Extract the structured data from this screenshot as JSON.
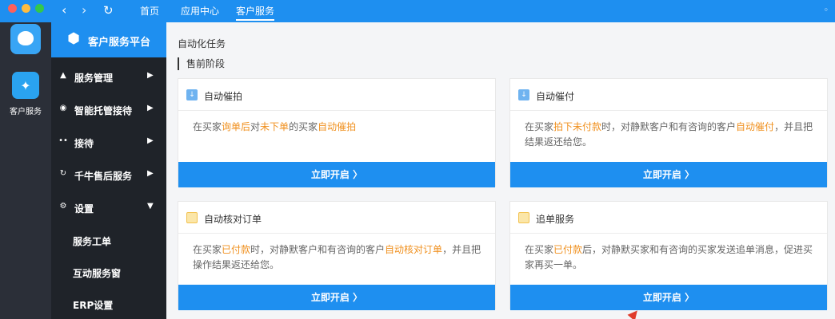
{
  "nav": {
    "back_icon": "chevron-left-icon",
    "forward_icon": "chevron-right-icon",
    "refresh_icon": "refresh-icon",
    "tabs": [
      {
        "label": "首页"
      },
      {
        "label": "应用中心"
      },
      {
        "label": "客户服务",
        "active": true
      }
    ]
  },
  "rail": {
    "app_label": "客户服务"
  },
  "sidebar": {
    "title": "客户服务平台",
    "items": [
      {
        "label": "服务管理",
        "icon": "bell-icon"
      },
      {
        "label": "智能托管接待",
        "icon": "bulb-icon"
      },
      {
        "label": "接待",
        "icon": "users-icon"
      },
      {
        "label": "千牛售后服务",
        "icon": "refresh-icon"
      },
      {
        "label": "设置",
        "icon": "gear-icon",
        "expanded": true
      }
    ],
    "sub_items": [
      {
        "label": "服务工单"
      },
      {
        "label": "互动服务窗"
      },
      {
        "label": "ERP设置"
      }
    ]
  },
  "main": {
    "page_title": "自动化任务",
    "section_title": "售前阶段",
    "cards": [
      {
        "title": "自动催拍",
        "desc": [
          {
            "text": "在买家"
          },
          {
            "text": "询单后",
            "hl": true
          },
          {
            "text": "对"
          },
          {
            "text": "未下单",
            "hl": true
          },
          {
            "text": "的买家"
          },
          {
            "text": "自动催拍",
            "hl": true
          }
        ],
        "button": "立即开启 〉"
      },
      {
        "title": "自动催付",
        "desc": [
          {
            "text": "在买家"
          },
          {
            "text": "拍下未付款",
            "hl": true
          },
          {
            "text": "时，对静默客户和有咨询的客户"
          },
          {
            "text": "自动催付",
            "hl": true
          },
          {
            "text": "，并且把结果返还给您。"
          }
        ],
        "button": "立即开启 〉"
      },
      {
        "title": "自动核对订单",
        "desc": [
          {
            "text": "在买家"
          },
          {
            "text": "已付款",
            "hl": true
          },
          {
            "text": "时，对静默客户和有咨询的客户"
          },
          {
            "text": "自动核对订单",
            "hl": true
          },
          {
            "text": "，并且把操作结果返还给您。"
          }
        ],
        "button": "立即开启 〉"
      },
      {
        "title": "追单服务",
        "desc": [
          {
            "text": "在买家"
          },
          {
            "text": "已付款",
            "hl": true
          },
          {
            "text": "后，对静默买家和有咨询的买家发送追单消息，促进买家再买一单。"
          }
        ],
        "button": "立即开启 〉"
      }
    ]
  },
  "colors": {
    "brand_blue": "#1e8ff0",
    "highlight_orange": "#f0901e",
    "sidebar_dark": "#1f2329"
  }
}
